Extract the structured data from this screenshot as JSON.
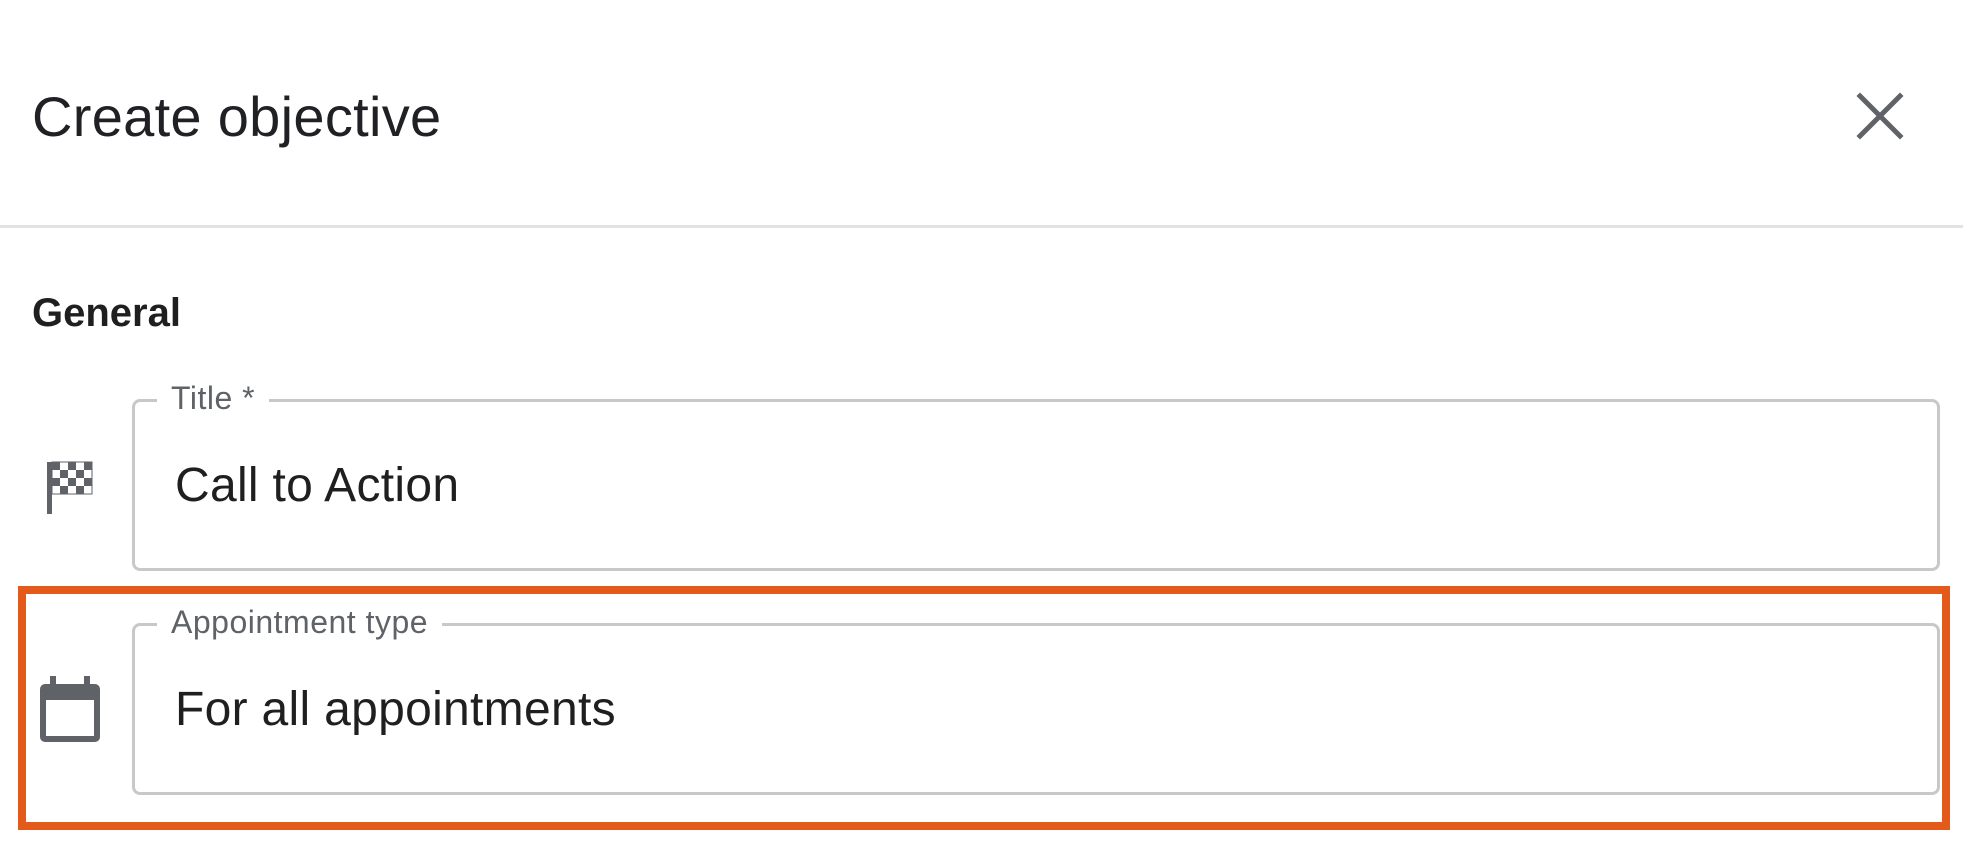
{
  "dialog": {
    "title": "Create objective",
    "close_icon": "close-icon"
  },
  "general": {
    "heading": "General",
    "title_field": {
      "icon": "checkered-flag-icon",
      "label": "Title *",
      "value": "Call to Action"
    },
    "appointment_field": {
      "icon": "calendar-icon",
      "label": "Appointment type",
      "value": "For all appointments"
    }
  },
  "colors": {
    "highlight": "#e35a1b",
    "field_border": "#c8c8c8",
    "label": "#5f6368",
    "icon": "#5f6368"
  }
}
